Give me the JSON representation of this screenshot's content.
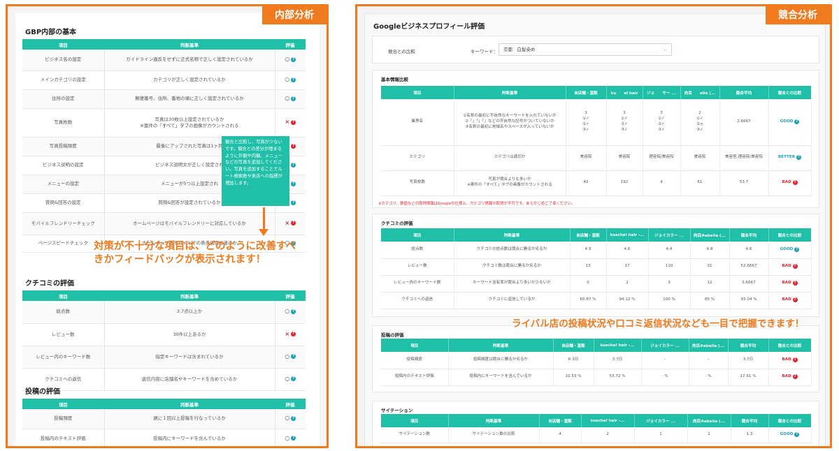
{
  "left": {
    "tag": "内部分析",
    "sections": [
      {
        "title": "GBP内部の基本",
        "headers": [
          "項目",
          "判断基準",
          "評価"
        ],
        "rows": [
          {
            "item": "ビジネス名の設定",
            "crit": "ガイドライン違反をせずに正式名称で正しく設定されているか",
            "mark": "○"
          },
          {
            "item": "メインカテゴリの設定",
            "crit": "カテゴリが正しく設定されているか",
            "mark": "○"
          },
          {
            "item": "住所の設定",
            "crit": "郵便番号、住所、番地の順に正しく設定されているか",
            "mark": "○"
          },
          {
            "item": "写真枚数",
            "crit": "写真は30枚以上設定されているか\n※案件の「すべて」タブの画像がカウントされる",
            "mark": "×"
          },
          {
            "item": "写真投稿頻度",
            "crit": "最後にアップされた写真は1ヶ月",
            "mark": "×"
          },
          {
            "item": "ビジネス説明の設定",
            "crit": "ビジネス説明文が正しく設定され",
            "mark": "○"
          },
          {
            "item": "メニューの設定",
            "crit": "メニューが5つ以上設定され",
            "mark": "○"
          },
          {
            "item": "質問&回答の設定",
            "crit": "質問&回答が設定されているか",
            "mark": "○"
          },
          {
            "item": "モバイルフレンドリーチェック",
            "crit": "ホームページはモバイルフレンドリーに対応しているか",
            "mark": "×"
          },
          {
            "item": "ページスピードチェック",
            "crit": "ホームページのモバイルでの表示速度は速いか",
            "mark": "○"
          }
        ]
      },
      {
        "title": "クチコミの評価",
        "headers": [
          "項目",
          "判断基準",
          "評価"
        ],
        "rows": [
          {
            "item": "総点数",
            "crit": "3.7点以上か",
            "mark": "○"
          },
          {
            "item": "レビュー数",
            "crit": "30件以上あるか",
            "mark": "×"
          },
          {
            "item": "レビュー内のキーワード数",
            "crit": "指定キーワードは含まれているか",
            "mark": "○"
          },
          {
            "item": "クチコミへの返信",
            "crit": "返信内容に店舗名やキーワードを含めているか",
            "mark": "○"
          }
        ]
      },
      {
        "title": "投稿の評価",
        "headers": [
          "項目",
          "判断基準",
          "評価"
        ],
        "rows": [
          {
            "item": "投稿頻度",
            "crit": "週に１回以上投稿を行なっているか",
            "mark": "○"
          },
          {
            "item": "投稿内のテキスト評価",
            "crit": "投稿内にキーワードを含んでいるか",
            "mark": "○"
          }
        ]
      }
    ],
    "tooltip": "競合と比較し、写真が少ないです。競合との差分が埋まるように外観や内観、メニューなどの写真を追加してください。写真を追加することでルート検索数や来店への指標が増加します。",
    "callout": "対策が不十分な項目は、どのように改善すべきかフィードバックが表示されます！"
  },
  "right": {
    "tag": "競合分析",
    "title": "Googleビジネスプロフィール評価",
    "compare_label": "競合との比較",
    "keyword_label": "キーワード：",
    "keyword_value": "京都　白髪染め",
    "basic": {
      "title": "基本情報比較",
      "headers": [
        "項目",
        "判断基準",
        "自店舗・直販",
        "ku　　el hair",
        "ジョ　　サー ...",
        "肉目　　elia (...",
        "競合平均",
        "競合との比較"
      ],
      "rows": [
        {
          "item": "業界名",
          "crit": "①名称の最初に不自然なキーワードを入れていないか\n②「」「」「」などの不自然な記号がついていないか\n③名称の最初に地域名やスペースが入っていないか",
          "c1": "3\n①✓\n②✓\n③✓",
          "c2": "3\n①✓\n②✓\n③✓",
          "c3": "3\n①✓\n②✓\n③✓",
          "c4": "2\n①✓\n②×\n③✓",
          "avg": "2.6667",
          "res": "GOOD"
        },
        {
          "item": "カテゴリ",
          "crit": "カテゴリは適切か",
          "c1": "美容院",
          "c2": "美容院",
          "c3": "理容院/美容院",
          "c4": "美容院",
          "avg": "美容室,理容院/美容院",
          "res": "BETTER"
        },
        {
          "item": "写真枚数",
          "crit": "写真が競合よりも多いか\n※案件の「すべて」タブの画像がカウントされる",
          "c1": "42",
          "c2": "192",
          "c3": "4",
          "c4": "61",
          "avg": "53.7",
          "res": "BAD"
        }
      ],
      "note": "※カテゴリ、数値などの取得情報はGoogleの仕様上、カテゴリ情報の取得が不可です。あらかじめご了承ください。"
    },
    "reviews": {
      "title": "クチコミの評価",
      "headers": [
        "項目",
        "判断基準",
        "自店舗・直販",
        "kuschel hair -...",
        "ジョイカラー ...",
        "肉目#abelia (...",
        "競合平均",
        "競合との比較"
      ],
      "rows": [
        {
          "item": "総点数",
          "crit": "クチコミの総点数は競合に勝るか劣るか",
          "c1": "4.9",
          "c2": "4.6",
          "c3": "4.4",
          "c4": "4.8",
          "avg": "4.6",
          "res": "GOOD"
        },
        {
          "item": "レビュー数",
          "crit": "クチコミ数は競合に勝るか劣るか",
          "c1": "13",
          "c2": "17",
          "c3": "110",
          "c4": "31",
          "avg": "52.6667",
          "res": "BAD"
        },
        {
          "item": "レビュー内のキーワード数",
          "crit": "キーワード含有率が競合より多いか少ないか",
          "c1": "0",
          "c2": "2",
          "c3": "3",
          "c4": "12",
          "avg": "5.6667",
          "res": "BAD"
        },
        {
          "item": "クチコミへの返信",
          "crit": "クチコミに返信しているか",
          "c1": "60.87 %",
          "c2": "94.12 %",
          "c3": "100 %",
          "c4": "85 %",
          "avg": "93.04 %",
          "res": "BAD"
        }
      ]
    },
    "posts": {
      "title": "投稿の評価",
      "headers": [
        "項目",
        "判断基準",
        "自店舗・直販",
        "kuschel hair -...",
        "ジョイカラー ...",
        "肉目#abelia (...",
        "競合平均",
        "競合との比較"
      ],
      "rows": [
        {
          "item": "投稿頻度",
          "crit": "投稿頻度は競合に勝るか劣るか",
          "c1": "6.3日",
          "c2": "3.7日",
          "c3": "-",
          "c4": "-",
          "avg": "3.7日",
          "res": "BAD"
        },
        {
          "item": "投稿内のテキスト評価",
          "crit": "投稿内にキーワードを含んでいるか",
          "c1": "10.53 %",
          "c2": "53.72 %",
          "c3": "- %",
          "c4": "- %",
          "avg": "17.91 %",
          "res": "BAD"
        }
      ]
    },
    "citation": {
      "title": "サイテーション",
      "headers": [
        "項目",
        "判断基準",
        "自店舗・直販",
        "kuschel hair -...",
        "ジョイカラー ...",
        "肉目#abelia (...",
        "競合平均",
        "競合との比較"
      ],
      "rows": [
        {
          "item": "サイテーション数",
          "crit": "サイテーション数の比較",
          "c1": "4",
          "c2": "2",
          "c3": "1",
          "c4": "1",
          "avg": "1.3",
          "res": "GOOD"
        }
      ]
    },
    "callout": "ライバル店の投稿状況や口コミ返信状況なども一目で把握できます！"
  }
}
